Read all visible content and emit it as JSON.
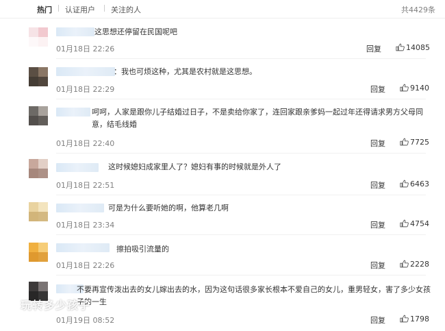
{
  "tabs": [
    {
      "label": "热门",
      "active": true
    },
    {
      "label": "认证用户",
      "active": false
    },
    {
      "label": "关注的人",
      "active": false
    }
  ],
  "total": "共4429条",
  "reply_label": "回复",
  "watermark": "玩转多少孩子",
  "comments": [
    {
      "text": "这思想还停留在民国呢吧",
      "time": "01月18日 22:26",
      "likes": "14085",
      "avatar_colors": [
        "#f6e3e6",
        "#f2c9cf",
        "#ffffff"
      ]
    },
    {
      "text": "：我也可烦这种，尤其是农村就是这思想。",
      "time": "01月18日 22:29",
      "likes": "9140",
      "avatar_colors": [
        "#5b4f44",
        "#8a7665",
        "#3e3730"
      ]
    },
    {
      "text": "呵呵，人家是跟你儿子结婚过日子，不是卖给你家了，连回家跟亲爹妈一起过年还得请求男方父母同意，结毛线婚",
      "time": "01月18日 22:40",
      "likes": "7725",
      "avatar_colors": [
        "#6d6a66",
        "#a8a29c",
        "#4b4744"
      ]
    },
    {
      "text": "这时候媳妇成家里人了？媳妇有事的时候就是外人了",
      "time": "01月18日 22:51",
      "likes": "6463",
      "avatar_colors": [
        "#c8a89c",
        "#e2cfc6",
        "#9b7c72"
      ]
    },
    {
      "text": "可是为什么要听她的啊，他算老几啊",
      "time": "01月18日 23:34",
      "likes": "4754",
      "avatar_colors": [
        "#e9d3a0",
        "#f3e4be",
        "#c9ab6e"
      ]
    },
    {
      "text": "擦拍吸引流量的",
      "time": "01月18日 22:26",
      "likes": "2228",
      "avatar_colors": [
        "#f0b040",
        "#f6cd78",
        "#d9912a"
      ]
    },
    {
      "text": "不要再宣传泼出去的女儿嫁出去的水，因为这句话很多家长根本不爱自己的女儿，重男轻女，害了多少女孩子的一生",
      "time": "01月19日 08:52",
      "likes": "1798",
      "avatar_colors": [
        "#3d3a3a",
        "#7a7474",
        "#222222"
      ]
    }
  ]
}
